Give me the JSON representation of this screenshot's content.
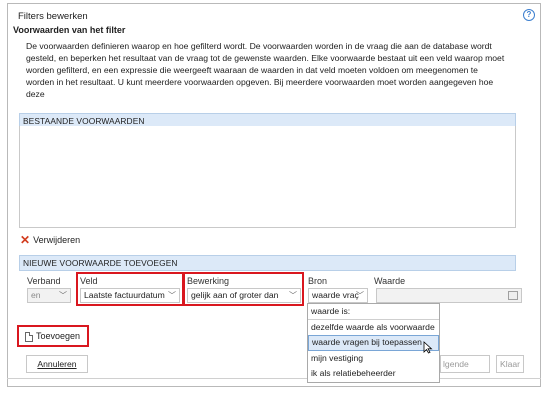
{
  "dialog": {
    "title": "Filters bewerken",
    "help_label": "?",
    "subtitle": "Voorwaarden van het filter",
    "description": "De voorwaarden definieren waarop en hoe gefilterd wordt. De voorwaarden worden in de vraag die aan de database wordt gesteld, en beperken het resultaat van de vraag tot de gewenste waarden. Elke voorwaarde bestaat uit een veld waarop moet worden gefilterd, en een expressie die weergeeft waaraan de waarden in dat veld moeten voldoen om meegenomen te worden in het resultaat. U kunt meerdere voorwaarden opgeven. Bij meerdere voorwaarden moet worden aangegeven hoe deze"
  },
  "existing": {
    "header": "BESTAANDE VOORWAARDEN",
    "remove_label": "Verwijderen"
  },
  "new_condition": {
    "header": "NIEUWE VOORWAARDE TOEVOEGEN",
    "labels": {
      "verband": "Verband",
      "veld": "Veld",
      "bewerking": "Bewerking",
      "bron": "Bron",
      "waarde": "Waarde"
    },
    "values": {
      "verband": "en",
      "veld": "Laatste factuurdatum",
      "bewerking": "gelijk aan of groter dan",
      "bron": "waarde vraç",
      "waarde": ""
    },
    "bron_options": [
      "waarde is:",
      "dezelfde waarde als voorwaarde",
      "waarde vragen bij toepassen",
      "mijn vestiging",
      "ik als relatiebeheerder"
    ],
    "highlighted_option_index": 2,
    "add_label": "Toevoegen"
  },
  "footer": {
    "cancel_label": "Annuleren",
    "next_label": "Volgende",
    "next_visible": "lgende",
    "finish_label": "Klaar"
  },
  "colors": {
    "highlight_red": "#d9171f",
    "section_header_bg": "#dce9f8",
    "remove_icon": "#d23c1e"
  }
}
